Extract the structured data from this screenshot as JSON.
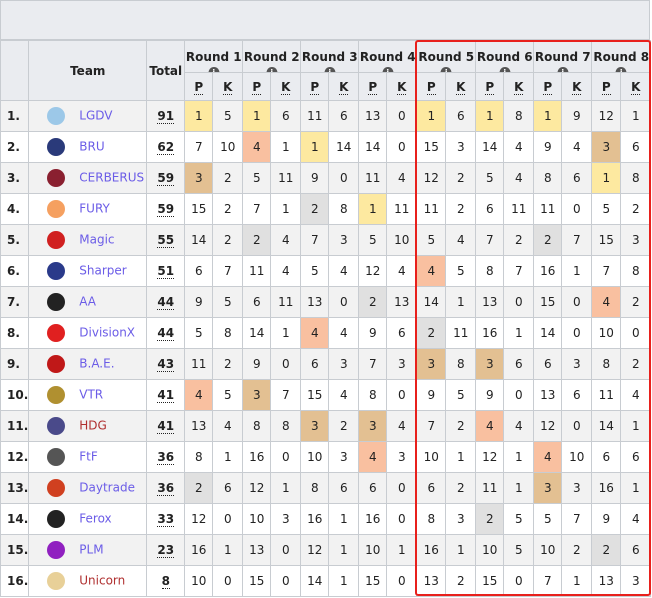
{
  "header": {
    "team": "Team",
    "total": "Total",
    "p": "P",
    "k": "K",
    "info_icon": "i",
    "rounds": [
      "Round 1",
      "Round 2",
      "Round 3",
      "Round 4",
      "Round 5",
      "Round 6",
      "Round 7",
      "Round 8"
    ]
  },
  "colors": {
    "place_1": "#fde9a0",
    "place_2": "#e0e0e0",
    "place_3": "#e3c092",
    "place_4": "#f9c0a0",
    "highlight_box": "#e8201c"
  },
  "rows": [
    {
      "rank": "1.",
      "team": "LGDV",
      "logo": "#9cc8e8",
      "total": "91",
      "rounds": [
        [
          1,
          5
        ],
        [
          1,
          6
        ],
        [
          11,
          6
        ],
        [
          13,
          0
        ],
        [
          1,
          6
        ],
        [
          1,
          8
        ],
        [
          1,
          9
        ],
        [
          12,
          1
        ]
      ]
    },
    {
      "rank": "2.",
      "team": "BRU",
      "logo": "#2a3a7a",
      "total": "62",
      "rounds": [
        [
          7,
          10
        ],
        [
          4,
          1
        ],
        [
          1,
          14
        ],
        [
          14,
          0
        ],
        [
          15,
          3
        ],
        [
          14,
          4
        ],
        [
          9,
          4
        ],
        [
          3,
          6
        ]
      ]
    },
    {
      "rank": "3.",
      "team": "CERBERUS",
      "logo": "#8a2030",
      "total": "59",
      "rounds": [
        [
          3,
          2
        ],
        [
          5,
          11
        ],
        [
          9,
          0
        ],
        [
          11,
          4
        ],
        [
          12,
          2
        ],
        [
          5,
          4
        ],
        [
          8,
          6
        ],
        [
          1,
          8
        ]
      ]
    },
    {
      "rank": "4.",
      "team": "FURY",
      "logo": "#f5a060",
      "total": "59",
      "rounds": [
        [
          15,
          2
        ],
        [
          7,
          1
        ],
        [
          2,
          8
        ],
        [
          1,
          11
        ],
        [
          11,
          2
        ],
        [
          6,
          11
        ],
        [
          11,
          0
        ],
        [
          5,
          2
        ]
      ]
    },
    {
      "rank": "5.",
      "team": "Magic",
      "logo": "#d02020",
      "total": "55",
      "rounds": [
        [
          14,
          2
        ],
        [
          2,
          4
        ],
        [
          7,
          3
        ],
        [
          5,
          10
        ],
        [
          5,
          4
        ],
        [
          7,
          2
        ],
        [
          2,
          7
        ],
        [
          15,
          3
        ]
      ]
    },
    {
      "rank": "6.",
      "team": "Sharper",
      "logo": "#2a3a8a",
      "total": "51",
      "rounds": [
        [
          6,
          7
        ],
        [
          11,
          4
        ],
        [
          5,
          4
        ],
        [
          12,
          4
        ],
        [
          4,
          5
        ],
        [
          8,
          7
        ],
        [
          16,
          1
        ],
        [
          7,
          8
        ]
      ]
    },
    {
      "rank": "7.",
      "team": "AA",
      "logo": "#222222",
      "total": "44",
      "rounds": [
        [
          9,
          5
        ],
        [
          6,
          11
        ],
        [
          13,
          0
        ],
        [
          2,
          13
        ],
        [
          14,
          1
        ],
        [
          13,
          0
        ],
        [
          15,
          0
        ],
        [
          4,
          2
        ]
      ]
    },
    {
      "rank": "8.",
      "team": "DivisionX",
      "logo": "#e02020",
      "total": "44",
      "rounds": [
        [
          5,
          8
        ],
        [
          14,
          1
        ],
        [
          4,
          4
        ],
        [
          9,
          6
        ],
        [
          2,
          11
        ],
        [
          16,
          1
        ],
        [
          14,
          0
        ],
        [
          10,
          0
        ]
      ]
    },
    {
      "rank": "9.",
      "team": "B.A.E.",
      "logo": "#c01818",
      "total": "43",
      "rounds": [
        [
          11,
          2
        ],
        [
          9,
          0
        ],
        [
          6,
          3
        ],
        [
          7,
          3
        ],
        [
          3,
          8
        ],
        [
          3,
          6
        ],
        [
          6,
          3
        ],
        [
          8,
          2
        ]
      ]
    },
    {
      "rank": "10.",
      "team": "VTR",
      "logo": "#b09030",
      "total": "41",
      "rounds": [
        [
          4,
          5
        ],
        [
          3,
          7
        ],
        [
          15,
          4
        ],
        [
          8,
          0
        ],
        [
          9,
          5
        ],
        [
          9,
          0
        ],
        [
          13,
          6
        ],
        [
          11,
          4
        ]
      ]
    },
    {
      "rank": "11.",
      "team": "HDG",
      "logo": "#4a4a8a",
      "total": "41",
      "red": true,
      "rounds": [
        [
          13,
          4
        ],
        [
          8,
          8
        ],
        [
          3,
          2
        ],
        [
          3,
          4
        ],
        [
          7,
          2
        ],
        [
          4,
          4
        ],
        [
          12,
          0
        ],
        [
          14,
          1
        ]
      ]
    },
    {
      "rank": "12.",
      "team": "FtF",
      "logo": "#555555",
      "total": "36",
      "rounds": [
        [
          8,
          1
        ],
        [
          16,
          0
        ],
        [
          10,
          3
        ],
        [
          4,
          3
        ],
        [
          10,
          1
        ],
        [
          12,
          1
        ],
        [
          4,
          10
        ],
        [
          6,
          6
        ]
      ]
    },
    {
      "rank": "13.",
      "team": "Daytrade",
      "logo": "#d04020",
      "total": "36",
      "rounds": [
        [
          2,
          6
        ],
        [
          12,
          1
        ],
        [
          8,
          6
        ],
        [
          6,
          0
        ],
        [
          6,
          2
        ],
        [
          11,
          1
        ],
        [
          3,
          3
        ],
        [
          16,
          1
        ]
      ]
    },
    {
      "rank": "14.",
      "team": "Ferox",
      "logo": "#222222",
      "total": "33",
      "rounds": [
        [
          12,
          0
        ],
        [
          10,
          3
        ],
        [
          16,
          1
        ],
        [
          16,
          0
        ],
        [
          8,
          3
        ],
        [
          2,
          5
        ],
        [
          5,
          7
        ],
        [
          9,
          4
        ]
      ]
    },
    {
      "rank": "15.",
      "team": "PLM",
      "logo": "#9020c0",
      "total": "23",
      "rounds": [
        [
          16,
          1
        ],
        [
          13,
          0
        ],
        [
          12,
          1
        ],
        [
          10,
          1
        ],
        [
          16,
          1
        ],
        [
          10,
          5
        ],
        [
          10,
          2
        ],
        [
          2,
          6
        ]
      ]
    },
    {
      "rank": "16.",
      "team": "Unicorn",
      "logo": "#e8d098",
      "total": "8",
      "red": true,
      "rounds": [
        [
          10,
          0
        ],
        [
          15,
          0
        ],
        [
          14,
          1
        ],
        [
          15,
          0
        ],
        [
          13,
          2
        ],
        [
          15,
          0
        ],
        [
          7,
          1
        ],
        [
          13,
          3
        ]
      ]
    }
  ]
}
